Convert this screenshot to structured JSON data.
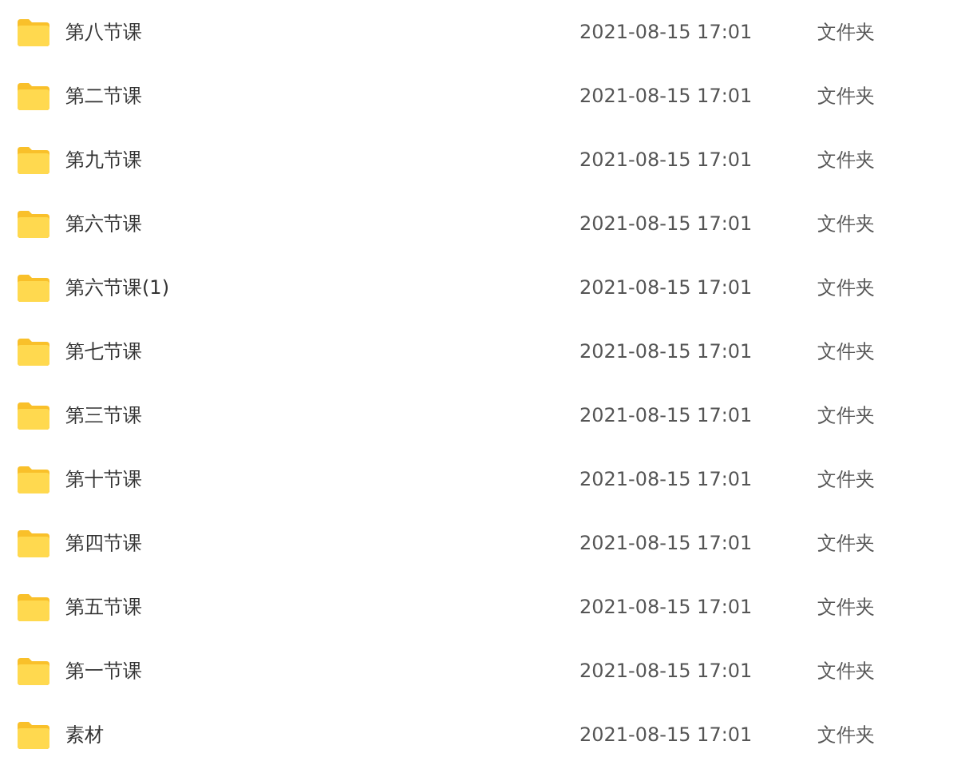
{
  "files": [
    {
      "name": "第八节课",
      "modified": "2021-08-15 17:01",
      "type": "文件夹"
    },
    {
      "name": "第二节课",
      "modified": "2021-08-15 17:01",
      "type": "文件夹"
    },
    {
      "name": "第九节课",
      "modified": "2021-08-15 17:01",
      "type": "文件夹"
    },
    {
      "name": "第六节课",
      "modified": "2021-08-15 17:01",
      "type": "文件夹"
    },
    {
      "name": "第六节课(1)",
      "modified": "2021-08-15 17:01",
      "type": "文件夹"
    },
    {
      "name": "第七节课",
      "modified": "2021-08-15 17:01",
      "type": "文件夹"
    },
    {
      "name": "第三节课",
      "modified": "2021-08-15 17:01",
      "type": "文件夹"
    },
    {
      "name": "第十节课",
      "modified": "2021-08-15 17:01",
      "type": "文件夹"
    },
    {
      "name": "第四节课",
      "modified": "2021-08-15 17:01",
      "type": "文件夹"
    },
    {
      "name": "第五节课",
      "modified": "2021-08-15 17:01",
      "type": "文件夹"
    },
    {
      "name": "第一节课",
      "modified": "2021-08-15 17:01",
      "type": "文件夹"
    },
    {
      "name": "素材",
      "modified": "2021-08-15 17:01",
      "type": "文件夹"
    }
  ]
}
